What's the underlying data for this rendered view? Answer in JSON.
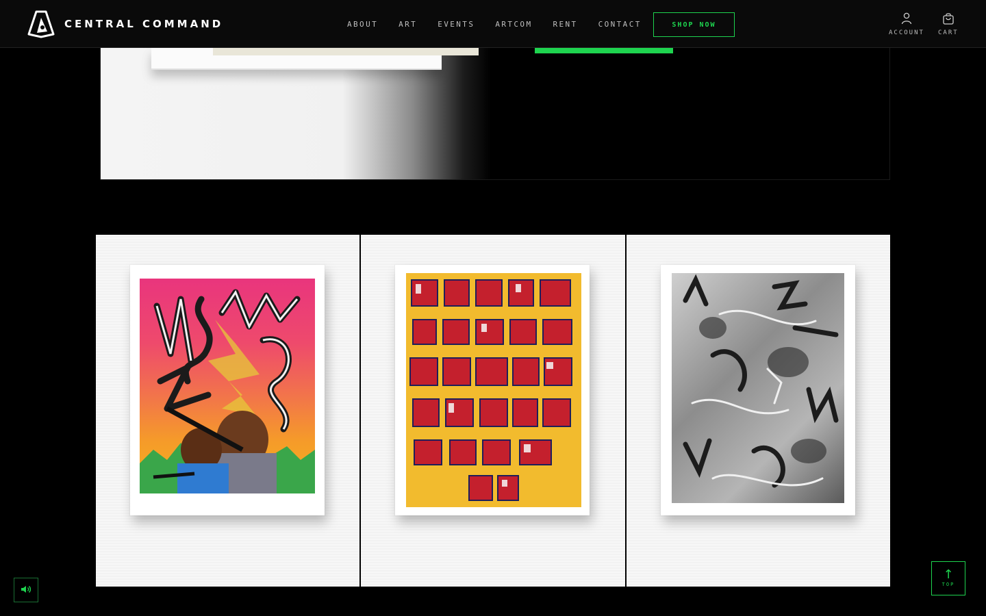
{
  "header": {
    "brand": "CENTRAL COMMAND",
    "nav": [
      "ABOUT",
      "ART",
      "EVENTS",
      "ARTCOM",
      "RENT",
      "CONTACT"
    ],
    "shop_label": "SHOP NOW",
    "account_label": "ACCOUNT",
    "cart_label": "CART",
    "icons": {
      "logo": "central-command-logo",
      "account": "user-icon",
      "cart": "shopping-bag-icon"
    }
  },
  "footer_widgets": {
    "sound_icon": "speaker-icon",
    "top_label": "TOP",
    "top_icon": "arrow-up-icon"
  },
  "colors": {
    "accent": "#1ed44f",
    "background": "#000000"
  }
}
